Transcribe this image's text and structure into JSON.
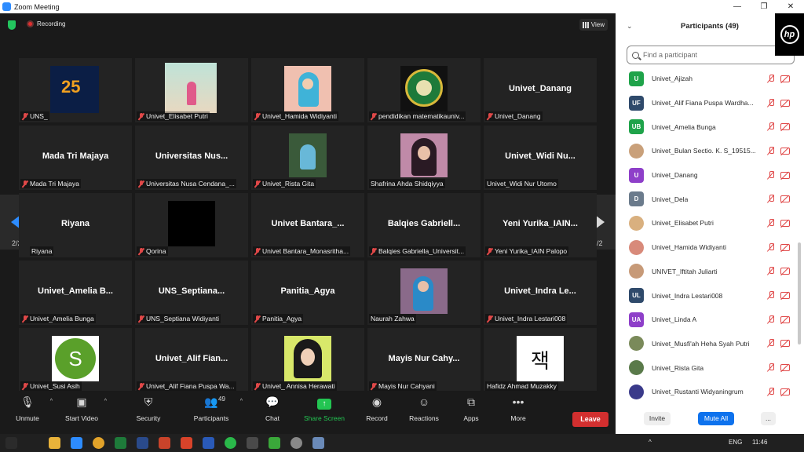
{
  "window": {
    "title": "Zoom Meeting",
    "controls": [
      "—",
      "❐",
      "✕"
    ]
  },
  "meeting": {
    "recording_label": "Recording",
    "view_label": "View",
    "page_left": "2/2",
    "page_right": "2/2"
  },
  "tiles": [
    {
      "big": "",
      "label": "UNS_"
    },
    {
      "big": "",
      "label": "Univet_Elisabet Putri"
    },
    {
      "big": "",
      "label": "Univet_Hamida Widiyanti"
    },
    {
      "big": "",
      "label": "pendidikan matematikauniv..."
    },
    {
      "big": "Univet_Danang",
      "label": "Univet_Danang"
    },
    {
      "big": "Mada Tri Majaya",
      "label": "Mada Tri Majaya"
    },
    {
      "big": "Universitas  Nus...",
      "label": "Universitas Nusa Cendana_..."
    },
    {
      "big": "",
      "label": "Univet_Rista Gita"
    },
    {
      "big": "",
      "label": "Shafrina Ahda Shidqiyya"
    },
    {
      "big": "Univet_Widi  Nu...",
      "label": "Univet_Widi Nur Utomo"
    },
    {
      "big": "Riyana",
      "label": "Riyana"
    },
    {
      "big": "",
      "label": "Qorina"
    },
    {
      "big": "Univet  Bantara_...",
      "label": "Univet Bantara_Monasritha..."
    },
    {
      "big": "Balqies  Gabriell...",
      "label": "Balqies Gabriella_Universit..."
    },
    {
      "big": "Yeni  Yurika_IAIN...",
      "label": "Yeni Yurika_IAIN Palopo"
    },
    {
      "big": "Univet_Amelia  B...",
      "label": "Univet_Amelia Bunga"
    },
    {
      "big": "UNS_Septiana...",
      "label": "UNS_Septiana Widiyanti"
    },
    {
      "big": "Panitia_Agya",
      "label": "Panitia_Agya"
    },
    {
      "big": "",
      "label": "Naurah Zahwa"
    },
    {
      "big": "Univet_Indra  Le...",
      "label": "Univet_Indra Lestari008"
    },
    {
      "big": "",
      "label": "Univet_Susi Asih"
    },
    {
      "big": "Univet_Alif  Fian...",
      "label": "Univet_Alif Fiana Puspa Wa..."
    },
    {
      "big": "",
      "label": "Univet_ Annisa Herawati"
    },
    {
      "big": "Mayis  Nur  Cahy...",
      "label": "Mayis Nur Cahyani"
    },
    {
      "big": "",
      "label": "Hafidz Ahmad Muzakky"
    }
  ],
  "tile_extras": {
    "susi_initial": "S",
    "hafidz_char": "잭"
  },
  "toolbar": {
    "unmute": "Unmute",
    "start_video": "Start Video",
    "security": "Security",
    "participants": "Participants",
    "participants_count": "49",
    "chat": "Chat",
    "share_screen": "Share Screen",
    "record": "Record",
    "reactions": "Reactions",
    "apps": "Apps",
    "more": "More",
    "leave": "Leave"
  },
  "panel": {
    "title": "Participants (49)",
    "search_placeholder": "Find a participant",
    "participants": [
      {
        "initials": "U",
        "color": "#1fa34a",
        "name": "Univet_Ajizah"
      },
      {
        "initials": "UF",
        "color": "#2f4a6b",
        "name": "Univet_Alif Fiana Puspa Wardha..."
      },
      {
        "initials": "UB",
        "color": "#1fa34a",
        "name": "Univet_Amelia Bunga"
      },
      {
        "initials": "",
        "color": "#c9a07a",
        "name": "Univet_Bulan Sectio. K. S_19515..."
      },
      {
        "initials": "U",
        "color": "#8e3fc9",
        "name": "Univet_Danang"
      },
      {
        "initials": "D",
        "color": "#6b7b8c",
        "name": "Univet_Dela"
      },
      {
        "initials": "",
        "color": "#d9b07f",
        "name": "Univet_Elisabet Putri"
      },
      {
        "initials": "",
        "color": "#d88a7a",
        "name": "Univet_Hamida Widiyanti"
      },
      {
        "initials": "",
        "color": "#c79a78",
        "name": "UNIVET_Iftitah Juliarti"
      },
      {
        "initials": "UL",
        "color": "#2f4a6b",
        "name": "Univet_Indra Lestari008"
      },
      {
        "initials": "UA",
        "color": "#8e3fc9",
        "name": "Univet_Linda A"
      },
      {
        "initials": "",
        "color": "#7a8a5a",
        "name": "Univet_Musfi'ah Heha Syah Putri"
      },
      {
        "initials": "",
        "color": "#5a7a4a",
        "name": "Univet_Rista Gita"
      },
      {
        "initials": "",
        "color": "#3a3a8a",
        "name": "Univet_Rustanti Widyaningrum"
      }
    ],
    "invite": "Invite",
    "mute_all": "Mute All",
    "more": "..."
  },
  "taskbar": {
    "lang": "ENG",
    "time": "11:46"
  }
}
